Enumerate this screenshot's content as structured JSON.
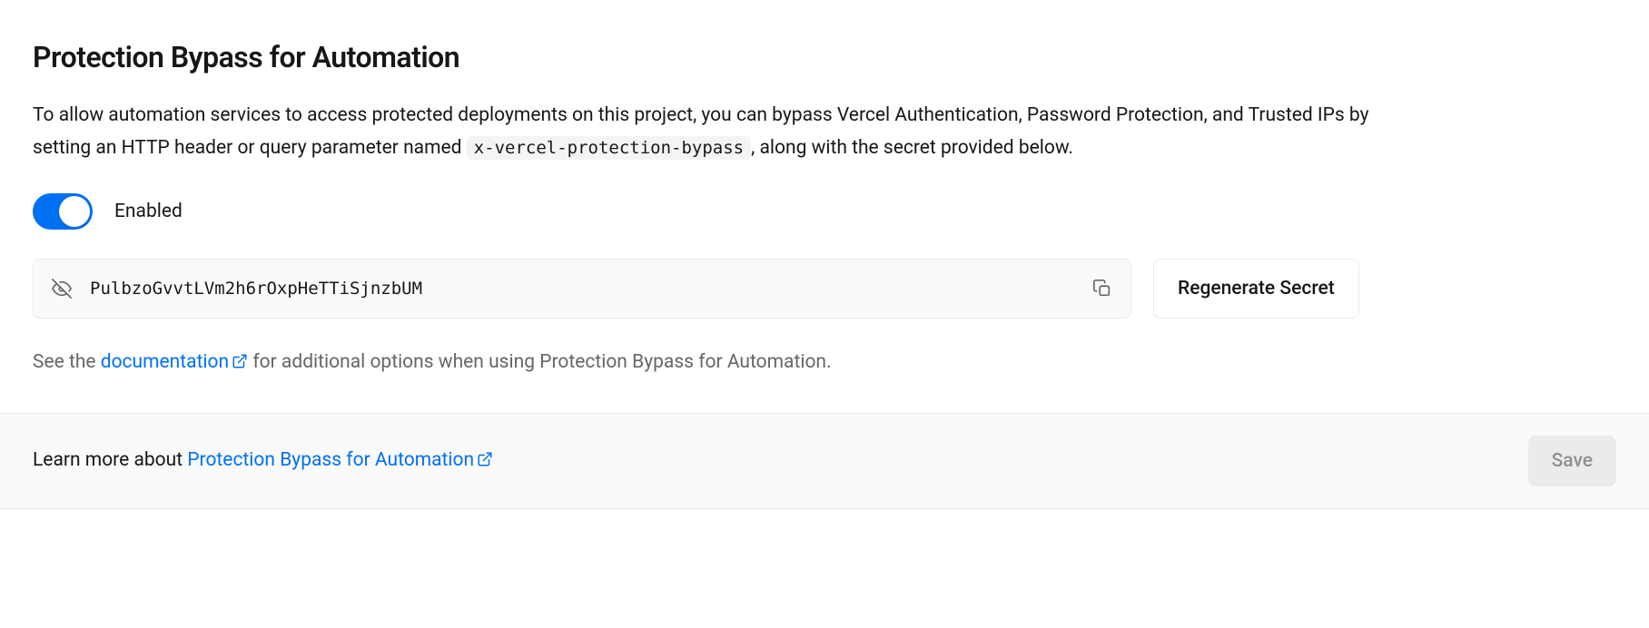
{
  "section": {
    "title": "Protection Bypass for Automation",
    "description_pre": "To allow automation services to access protected deployments on this project, you can bypass Vercel Authentication, Password Protection, and Trusted IPs by setting an HTTP header or query parameter named ",
    "header_name": "x-vercel-protection-bypass",
    "description_post": ", along with the secret provided below."
  },
  "toggle": {
    "enabled": true,
    "label": "Enabled"
  },
  "secret": {
    "value": "PulbzoGvvtLVm2h6rOxpHeTTiSjnzbUM",
    "regenerate_label": "Regenerate Secret"
  },
  "doc_note": {
    "pre": "See the ",
    "link_text": "documentation",
    "post": " for additional options when using Protection Bypass for Automation."
  },
  "footer": {
    "learn_pre": "Learn more about ",
    "learn_link": "Protection Bypass for Automation",
    "save_label": "Save"
  }
}
